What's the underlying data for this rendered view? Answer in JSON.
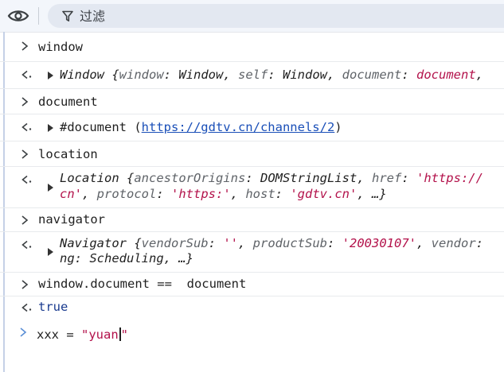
{
  "toolbar": {
    "eye_icon": "eye-icon",
    "filter_icon": "funnel-icon",
    "filter_placeholder": "过滤"
  },
  "colors": {
    "toolbar_bg": "#f3f6fb",
    "filter_bg": "#e3e8f1",
    "string": "#b3124b",
    "link": "#1a4fb8",
    "keyword_bool": "#1a3b8f"
  },
  "console": {
    "input_prompt": "›",
    "output_prompt": "‹·",
    "r1_in": "window",
    "r2_a": "Window {",
    "r2_k1": "window",
    "r2_c1": ": ",
    "r2_v1": "Window",
    "r2_sep1": ", ",
    "r2_k2": "self",
    "r2_c2": ": ",
    "r2_v2": "Window",
    "r2_sep2": ", ",
    "r2_k3": "document",
    "r2_c3": ": ",
    "r2_v3": "document",
    "r2_sep3": ",",
    "r3_in": "document",
    "r4_a": "#document (",
    "r4_link": "https://gdtv.cn/channels/2",
    "r4_b": ")",
    "r5_in": "location",
    "r6_a": "Location {",
    "r6_k1": "ancestorOrigins",
    "r6_c1": ": ",
    "r6_v1": "DOMStringList",
    "r6_sep1": ", ",
    "r6_k2": "href",
    "r6_c2": ": ",
    "r6_s2": "'https://",
    "r6_l2_s": "cn'",
    "r6_l2_sep1": ", ",
    "r6_l2_k1": "protocol",
    "r6_l2_c1": ": ",
    "r6_l2_s1": "'https:'",
    "r6_l2_sep2": ", ",
    "r6_l2_k2": "host",
    "r6_l2_c2": ": ",
    "r6_l2_s2": "'gdtv.cn'",
    "r6_l2_end": ", …}",
    "r7_in": "navigator",
    "r8_a": "Navigator {",
    "r8_k1": "vendorSub",
    "r8_c1": ": ",
    "r8_s1": "''",
    "r8_sep1": ", ",
    "r8_k2": "productSub",
    "r8_c2": ": ",
    "r8_s2": "'20030107'",
    "r8_sep2": ", ",
    "r8_k3": "vendor",
    "r8_c3": ":",
    "r8_l2_a": "ng: Scheduling, …}",
    "r9_in": "window.document ==  document",
    "r10_out": "true",
    "r11_a": "xxx = ",
    "r11_s": "\"yuan",
    "r11_s_end": "\""
  }
}
